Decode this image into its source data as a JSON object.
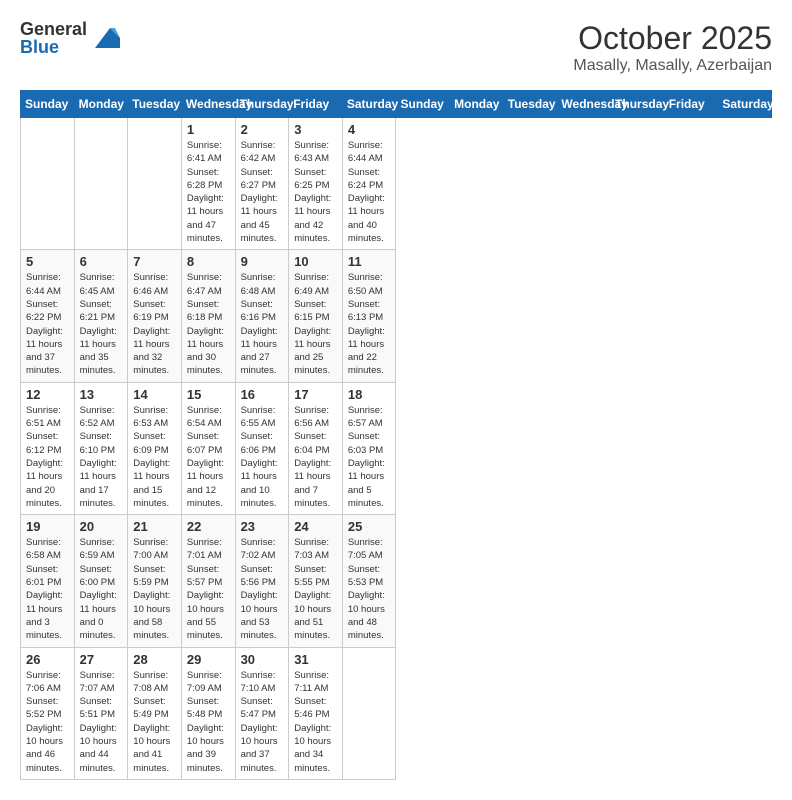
{
  "header": {
    "logo_general": "General",
    "logo_blue": "Blue",
    "month": "October 2025",
    "location": "Masally, Masally, Azerbaijan"
  },
  "days_of_week": [
    "Sunday",
    "Monday",
    "Tuesday",
    "Wednesday",
    "Thursday",
    "Friday",
    "Saturday"
  ],
  "weeks": [
    [
      {
        "day": "",
        "info": ""
      },
      {
        "day": "",
        "info": ""
      },
      {
        "day": "",
        "info": ""
      },
      {
        "day": "1",
        "info": "Sunrise: 6:41 AM\nSunset: 6:28 PM\nDaylight: 11 hours\nand 47 minutes."
      },
      {
        "day": "2",
        "info": "Sunrise: 6:42 AM\nSunset: 6:27 PM\nDaylight: 11 hours\nand 45 minutes."
      },
      {
        "day": "3",
        "info": "Sunrise: 6:43 AM\nSunset: 6:25 PM\nDaylight: 11 hours\nand 42 minutes."
      },
      {
        "day": "4",
        "info": "Sunrise: 6:44 AM\nSunset: 6:24 PM\nDaylight: 11 hours\nand 40 minutes."
      }
    ],
    [
      {
        "day": "5",
        "info": "Sunrise: 6:44 AM\nSunset: 6:22 PM\nDaylight: 11 hours\nand 37 minutes."
      },
      {
        "day": "6",
        "info": "Sunrise: 6:45 AM\nSunset: 6:21 PM\nDaylight: 11 hours\nand 35 minutes."
      },
      {
        "day": "7",
        "info": "Sunrise: 6:46 AM\nSunset: 6:19 PM\nDaylight: 11 hours\nand 32 minutes."
      },
      {
        "day": "8",
        "info": "Sunrise: 6:47 AM\nSunset: 6:18 PM\nDaylight: 11 hours\nand 30 minutes."
      },
      {
        "day": "9",
        "info": "Sunrise: 6:48 AM\nSunset: 6:16 PM\nDaylight: 11 hours\nand 27 minutes."
      },
      {
        "day": "10",
        "info": "Sunrise: 6:49 AM\nSunset: 6:15 PM\nDaylight: 11 hours\nand 25 minutes."
      },
      {
        "day": "11",
        "info": "Sunrise: 6:50 AM\nSunset: 6:13 PM\nDaylight: 11 hours\nand 22 minutes."
      }
    ],
    [
      {
        "day": "12",
        "info": "Sunrise: 6:51 AM\nSunset: 6:12 PM\nDaylight: 11 hours\nand 20 minutes."
      },
      {
        "day": "13",
        "info": "Sunrise: 6:52 AM\nSunset: 6:10 PM\nDaylight: 11 hours\nand 17 minutes."
      },
      {
        "day": "14",
        "info": "Sunrise: 6:53 AM\nSunset: 6:09 PM\nDaylight: 11 hours\nand 15 minutes."
      },
      {
        "day": "15",
        "info": "Sunrise: 6:54 AM\nSunset: 6:07 PM\nDaylight: 11 hours\nand 12 minutes."
      },
      {
        "day": "16",
        "info": "Sunrise: 6:55 AM\nSunset: 6:06 PM\nDaylight: 11 hours\nand 10 minutes."
      },
      {
        "day": "17",
        "info": "Sunrise: 6:56 AM\nSunset: 6:04 PM\nDaylight: 11 hours\nand 7 minutes."
      },
      {
        "day": "18",
        "info": "Sunrise: 6:57 AM\nSunset: 6:03 PM\nDaylight: 11 hours\nand 5 minutes."
      }
    ],
    [
      {
        "day": "19",
        "info": "Sunrise: 6:58 AM\nSunset: 6:01 PM\nDaylight: 11 hours\nand 3 minutes."
      },
      {
        "day": "20",
        "info": "Sunrise: 6:59 AM\nSunset: 6:00 PM\nDaylight: 11 hours\nand 0 minutes."
      },
      {
        "day": "21",
        "info": "Sunrise: 7:00 AM\nSunset: 5:59 PM\nDaylight: 10 hours\nand 58 minutes."
      },
      {
        "day": "22",
        "info": "Sunrise: 7:01 AM\nSunset: 5:57 PM\nDaylight: 10 hours\nand 55 minutes."
      },
      {
        "day": "23",
        "info": "Sunrise: 7:02 AM\nSunset: 5:56 PM\nDaylight: 10 hours\nand 53 minutes."
      },
      {
        "day": "24",
        "info": "Sunrise: 7:03 AM\nSunset: 5:55 PM\nDaylight: 10 hours\nand 51 minutes."
      },
      {
        "day": "25",
        "info": "Sunrise: 7:05 AM\nSunset: 5:53 PM\nDaylight: 10 hours\nand 48 minutes."
      }
    ],
    [
      {
        "day": "26",
        "info": "Sunrise: 7:06 AM\nSunset: 5:52 PM\nDaylight: 10 hours\nand 46 minutes."
      },
      {
        "day": "27",
        "info": "Sunrise: 7:07 AM\nSunset: 5:51 PM\nDaylight: 10 hours\nand 44 minutes."
      },
      {
        "day": "28",
        "info": "Sunrise: 7:08 AM\nSunset: 5:49 PM\nDaylight: 10 hours\nand 41 minutes."
      },
      {
        "day": "29",
        "info": "Sunrise: 7:09 AM\nSunset: 5:48 PM\nDaylight: 10 hours\nand 39 minutes."
      },
      {
        "day": "30",
        "info": "Sunrise: 7:10 AM\nSunset: 5:47 PM\nDaylight: 10 hours\nand 37 minutes."
      },
      {
        "day": "31",
        "info": "Sunrise: 7:11 AM\nSunset: 5:46 PM\nDaylight: 10 hours\nand 34 minutes."
      },
      {
        "day": "",
        "info": ""
      }
    ]
  ]
}
